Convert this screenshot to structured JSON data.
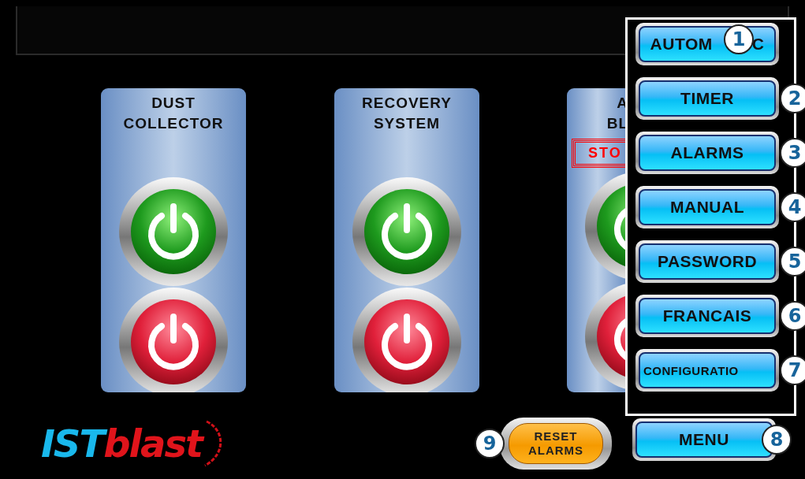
{
  "panels": [
    {
      "kind": "full",
      "title": [
        "DUST",
        "COLLECTOR"
      ],
      "buttons": [
        {
          "kind": "start"
        },
        {
          "kind": "stop"
        }
      ]
    },
    {
      "kind": "full",
      "title": [
        "RECOVERY",
        "SYSTEM"
      ],
      "buttons": [
        {
          "kind": "start"
        },
        {
          "kind": "stop"
        }
      ]
    },
    {
      "kind": "partial",
      "title": [
        "A",
        "BL"
      ],
      "status": "STO",
      "buttons": [
        {
          "kind": "start"
        },
        {
          "kind": "stop"
        }
      ]
    }
  ],
  "menu": {
    "items": [
      {
        "label": [
          "AUTOM",
          "C"
        ],
        "callout": "1"
      },
      {
        "label": [
          "TIMER"
        ],
        "callout": "2"
      },
      {
        "label": [
          "ALARMS"
        ],
        "callout": "3"
      },
      {
        "label": [
          "MANUAL"
        ],
        "callout": "4"
      },
      {
        "label": [
          "PASSWORD"
        ],
        "callout": "5"
      },
      {
        "label": [
          "FRANCAIS"
        ],
        "callout": "6"
      },
      {
        "label": [
          "CONFIGURATIO"
        ],
        "callout": "7",
        "small": true
      }
    ]
  },
  "menu_button": {
    "label": "MENU",
    "callout": "8"
  },
  "reset_button": {
    "label": [
      "RESET",
      "ALARMS"
    ],
    "callout": "9"
  },
  "logo": {
    "parts": [
      "IST",
      "blast"
    ]
  }
}
